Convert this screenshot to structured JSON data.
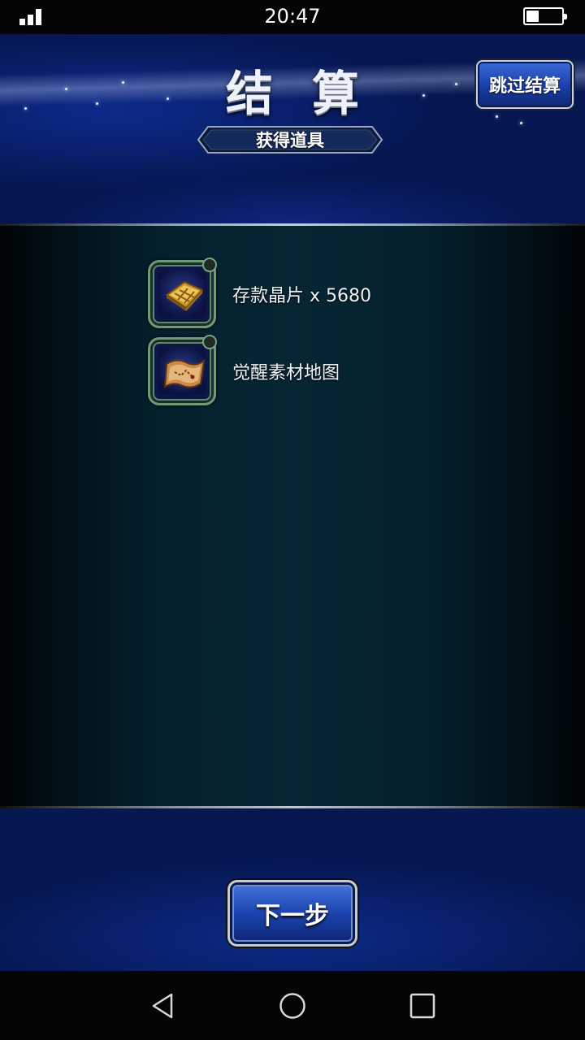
{
  "status_bar": {
    "time": "20:47",
    "battery_level": 0.35,
    "signal_bars": 3
  },
  "header": {
    "title": "结算",
    "skip_button_label": "跳过结算",
    "subtitle": "获得道具"
  },
  "items": [
    {
      "icon": "gold-chip-icon",
      "label": "存款晶片 x 5680"
    },
    {
      "icon": "treasure-map-icon",
      "label": "觉醒素材地图"
    }
  ],
  "footer": {
    "next_button_label": "下一步"
  },
  "nav_bar": {
    "buttons": [
      "back-icon",
      "home-icon",
      "recent-apps-icon"
    ]
  },
  "colors": {
    "header_blue": "#0c2a8a",
    "button_blue": "#1c44b0",
    "frame_green": "#6f9a78",
    "panel_teal": "#062633"
  }
}
